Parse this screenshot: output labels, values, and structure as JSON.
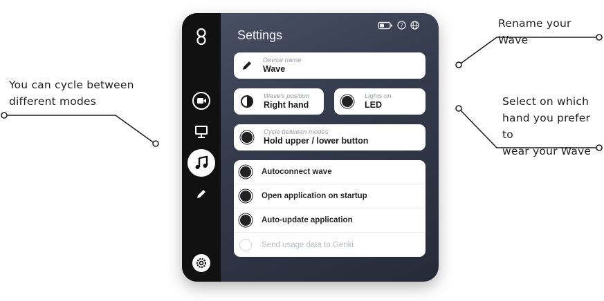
{
  "callouts": {
    "cycle_modes": {
      "line1": "You can cycle between",
      "line2": "different modes"
    },
    "rename": {
      "line1": "Rename your Wave"
    },
    "hand": {
      "line1": "Select on which",
      "line2": "hand you prefer to",
      "line3": "wear your Wave"
    }
  },
  "app": {
    "title": "Settings",
    "status_icons": [
      "battery-icon",
      "help-icon",
      "globe-icon"
    ],
    "sidebar": {
      "items": [
        {
          "icon": "logo-icon",
          "active": false
        },
        {
          "icon": "video-camera-icon",
          "active": false
        },
        {
          "icon": "monitor-icon",
          "active": false
        },
        {
          "icon": "music-note-icon",
          "active": true
        },
        {
          "icon": "pencil-icon",
          "active": false
        },
        {
          "icon": "gear-icon",
          "active": false
        }
      ]
    },
    "device_name": {
      "label": "Device name",
      "value": "Wave",
      "icon": "pencil-icon"
    },
    "position": {
      "label": "Wave's position",
      "value": "Right hand",
      "icon": "half-circle-icon"
    },
    "lights": {
      "label": "Lights on",
      "value": "LED",
      "icon": "radio-dot-icon"
    },
    "cycle": {
      "label": "Cycle between modes",
      "value": "Hold upper / lower button"
    },
    "options": [
      {
        "label": "Autoconnect wave",
        "checked": true
      },
      {
        "label": "Open application on startup",
        "checked": true
      },
      {
        "label": "Auto-update application",
        "checked": true
      },
      {
        "label": "Send usage data to Genki",
        "checked": false
      }
    ]
  },
  "colors": {
    "panel_top": "#4a5266",
    "panel_bottom": "#262b38",
    "sidebar": "#111111",
    "card": "#ffffff",
    "accent": "#1b1b1b"
  }
}
